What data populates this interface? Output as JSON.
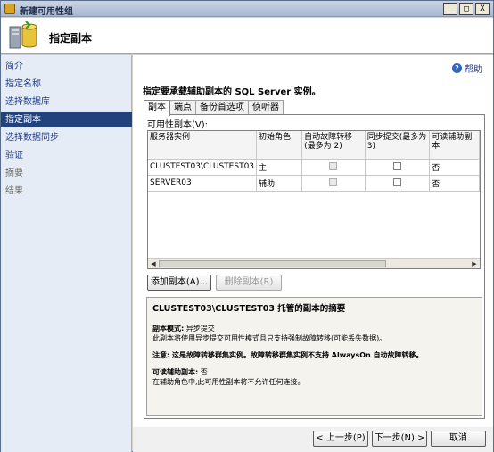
{
  "window": {
    "title": "新建可用性组",
    "buttons": [
      "_",
      "□",
      "X"
    ]
  },
  "header": {
    "title": "指定副本",
    "icon": "database-server-icon"
  },
  "sidebar": {
    "items": [
      {
        "label": "简介",
        "state": "link"
      },
      {
        "label": "指定名称",
        "state": "link"
      },
      {
        "label": "选择数据库",
        "state": "link"
      },
      {
        "label": "指定副本",
        "state": "active"
      },
      {
        "label": "选择数据同步",
        "state": "link"
      },
      {
        "label": "验证",
        "state": "link"
      },
      {
        "label": "摘要",
        "state": "disabled"
      },
      {
        "label": "结果",
        "state": "disabled"
      }
    ]
  },
  "main": {
    "help_label": "帮助",
    "instruction": "指定要承载辅助副本的 SQL Server 实例。",
    "tabs": [
      "副本",
      "端点",
      "备份首选项",
      "侦听器"
    ],
    "grid_caption": "可用性副本(V):",
    "columns": [
      "服务器实例",
      "初始角色",
      "自动故障转移(最多为 2)",
      "同步提交(最多为 3)",
      "可读辅助副本"
    ],
    "rows": [
      {
        "instance": "CLUSTEST03\\CLUSTEST03",
        "role": "主",
        "auto_failover": false,
        "sync_commit": false,
        "readable": "否"
      },
      {
        "instance": "SERVER03",
        "role": "辅助",
        "auto_failover": false,
        "sync_commit": false,
        "readable": "否"
      }
    ],
    "add_replica": "添加副本(A)...",
    "remove_replica": "删除副本(R)",
    "summary": {
      "title": "CLUSTEST03\\CLUSTEST03 托管的副本的摘要",
      "mode_label": "副本模式:",
      "mode_value": "异步提交",
      "mode_desc": "此副本将使用异步提交可用性模式且只支持强制故障转移(可能丢失数据)。",
      "note_label": "注意:",
      "note_text": "这是故障转移群集实例。故障转移群集实例不支持 AlwaysOn 自动故障转移。",
      "readable_label": "可读辅助副本:",
      "readable_value": "否",
      "readable_desc": "在辅助角色中,此可用性副本将不允许任何连接。"
    }
  },
  "footer": {
    "prev": "< 上一步(P)",
    "next": "下一步(N) >",
    "cancel": "取消"
  }
}
